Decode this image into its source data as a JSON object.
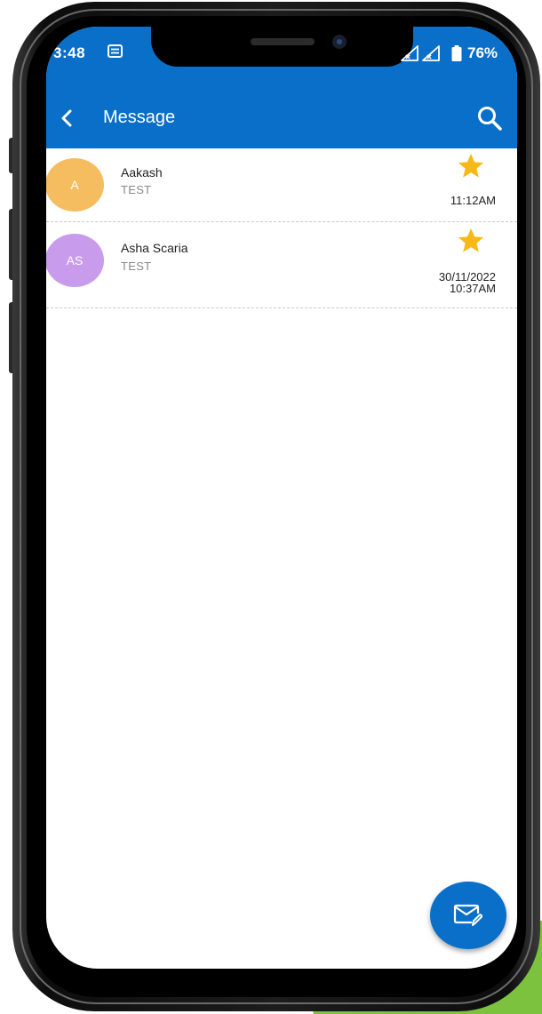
{
  "status_bar": {
    "time": "3:48",
    "battery": "76%",
    "notification_icon": "message-notification-icon",
    "signal_icon": "no-signal-icon",
    "battery_icon": "battery-icon"
  },
  "app_bar": {
    "title": "Message",
    "back_icon": "chevron-left-icon",
    "search_icon": "search-icon",
    "color": "#0a6fc9"
  },
  "messages": [
    {
      "initials": "A",
      "name": "Aakash",
      "snippet": "TEST",
      "time": "11:12AM",
      "date": "",
      "starred": true,
      "avatar_color": "#f5bd5f"
    },
    {
      "initials": "AS",
      "name": "Asha Scaria",
      "snippet": "TEST",
      "date": "30/11/2022",
      "time": "10:37AM",
      "starred": true,
      "avatar_color": "#c99bed"
    }
  ],
  "fab": {
    "icon": "compose-mail-icon"
  },
  "colors": {
    "star": "#f7b917",
    "divider": "#c9c9c9"
  }
}
